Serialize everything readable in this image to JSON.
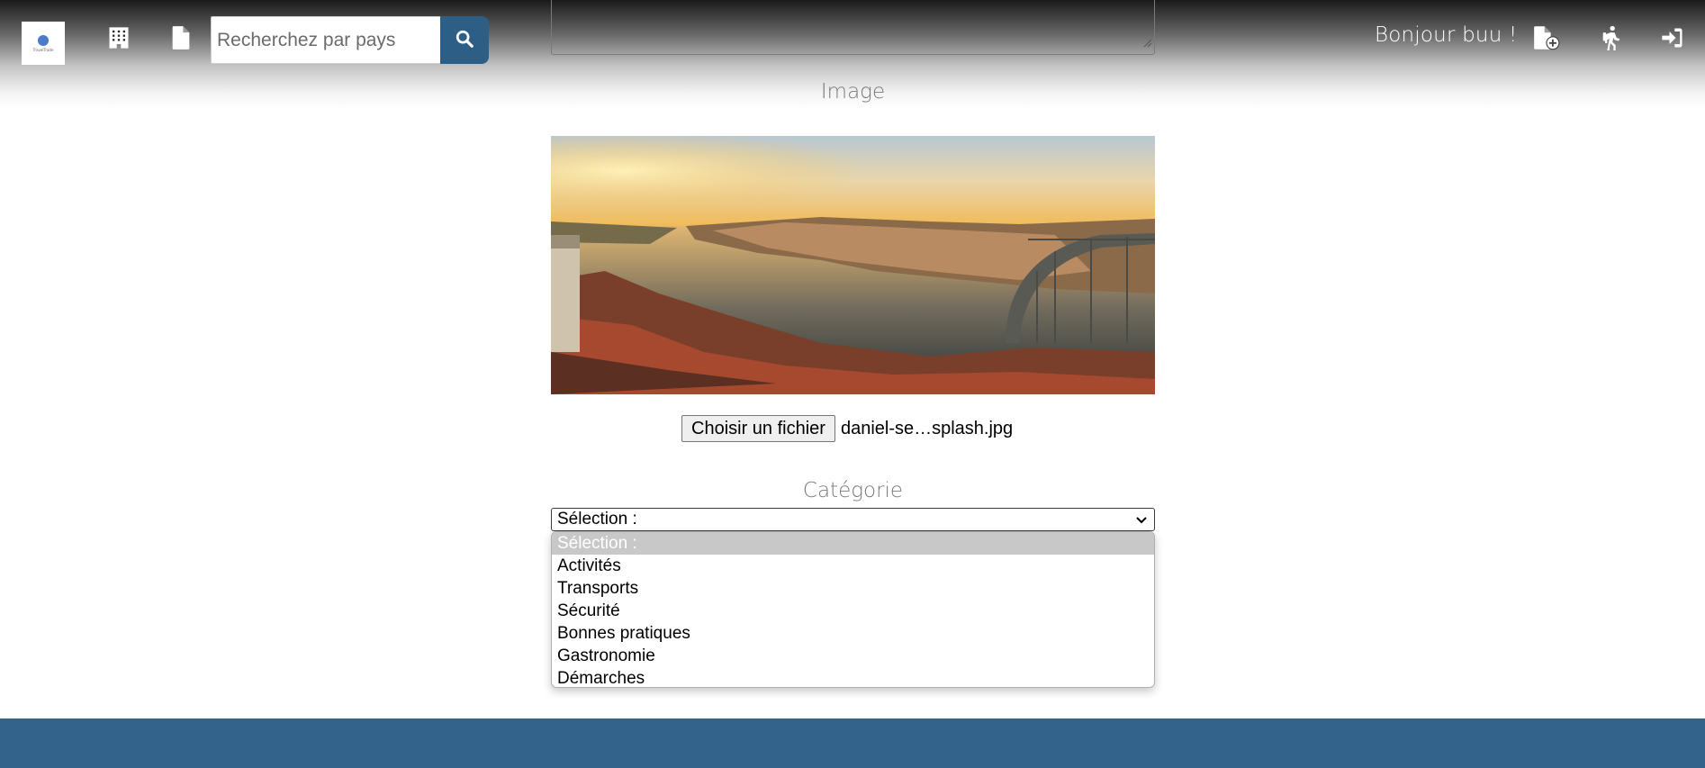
{
  "header": {
    "logo_alt": "TravelTrade",
    "search": {
      "placeholder": "Recherchez par pays",
      "value": ""
    },
    "greeting": "Bonjour buu !"
  },
  "form": {
    "image_label": "Image",
    "file_button_label": "Choisir un fichier",
    "file_name": "daniel-se…splash.jpg",
    "category_label": "Catégorie",
    "category_selected": "Sélection :",
    "category_options": [
      "Sélection :",
      "Activités",
      "Transports",
      "Sécurité",
      "Bonnes pratiques",
      "Gastronomie",
      "Démarches"
    ]
  },
  "icons": {
    "hotel": "building-icon",
    "document": "file-icon",
    "search": "search-icon",
    "add_document": "file-add-icon",
    "hiking": "hiking-icon",
    "login": "sign-in-icon"
  },
  "colors": {
    "accent": "#2d5f86",
    "footer": "#33628a",
    "option_highlight": "#c8c8c8"
  }
}
